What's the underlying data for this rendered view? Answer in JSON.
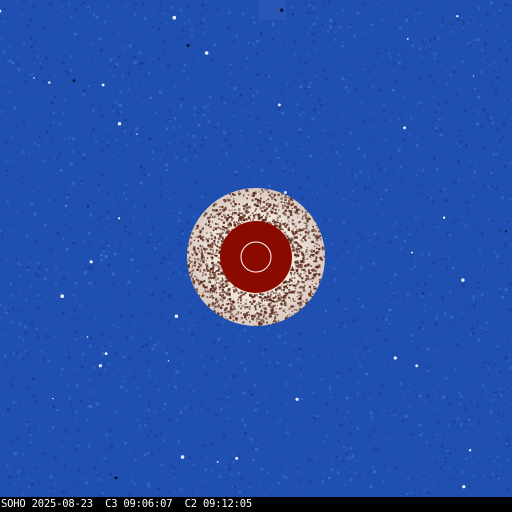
{
  "image": {
    "caption": "SOHO 2025-08-23  C3 09:06:07  C2 09:12:05",
    "colors": {
      "background": "#1f4fb0",
      "background_dark": "#163c92",
      "background_light": "#3a6fd0",
      "occulter_ring": "#f3ece4",
      "occulter_speckle": "#5a2a1a",
      "occulter_disk": "#8b0a00",
      "sun_outline": "#ffffff",
      "stars": "#e8f0ff",
      "caption_bar": "#000000"
    }
  }
}
